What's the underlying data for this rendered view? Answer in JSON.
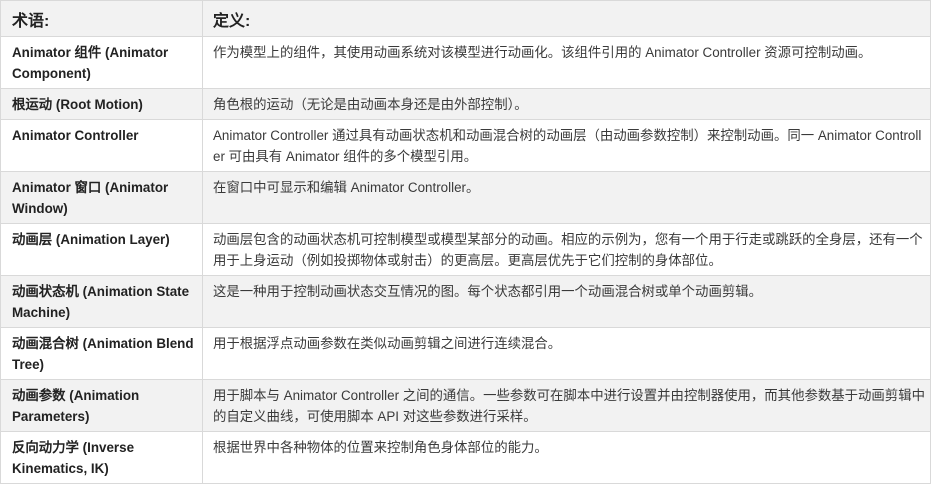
{
  "table": {
    "header": {
      "term": "术语:",
      "definition": "定义:"
    },
    "rows": [
      {
        "term": "Animator 组件 (Animator Component)",
        "definition": "作为模型上的组件，其使用动画系统对该模型进行动画化。该组件引用的 Animator Controller 资源可控制动画。"
      },
      {
        "term": "根运动 (Root Motion)",
        "definition": "角色根的运动（无论是由动画本身还是由外部控制）。"
      },
      {
        "term": "Animator Controller",
        "definition": "Animator Controller 通过具有动画状态机和动画混合树的动画层（由动画参数控制）来控制动画。同一 Animator Controller 可由具有 Animator 组件的多个模型引用。"
      },
      {
        "term": "Animator 窗口 (Animator Window)",
        "definition": "在窗口中可显示和编辑 Animator Controller。"
      },
      {
        "term": "动画层 (Animation Layer)",
        "definition": "动画层包含的动画状态机可控制模型或模型某部分的动画。相应的示例为，您有一个用于行走或跳跃的全身层，还有一个用于上身运动（例如投掷物体或射击）的更高层。更高层优先于它们控制的身体部位。"
      },
      {
        "term": "动画状态机 (Animation State Machine)",
        "definition": "这是一种用于控制动画状态交互情况的图。每个状态都引用一个动画混合树或单个动画剪辑。"
      },
      {
        "term": "动画混合树 (Animation Blend Tree)",
        "definition": "用于根据浮点动画参数在类似动画剪辑之间进行连续混合。"
      },
      {
        "term": "动画参数 (Animation Parameters)",
        "definition": "用于脚本与 Animator Controller 之间的通信。一些参数可在脚本中进行设置并由控制器使用，而其他参数基于动画剪辑中的自定义曲线，可使用脚本 API 对这些参数进行采样。"
      },
      {
        "term": "反向动力学 (Inverse Kinematics, IK)",
        "definition": "根据世界中各种物体的位置来控制角色身体部位的能力。"
      }
    ]
  }
}
